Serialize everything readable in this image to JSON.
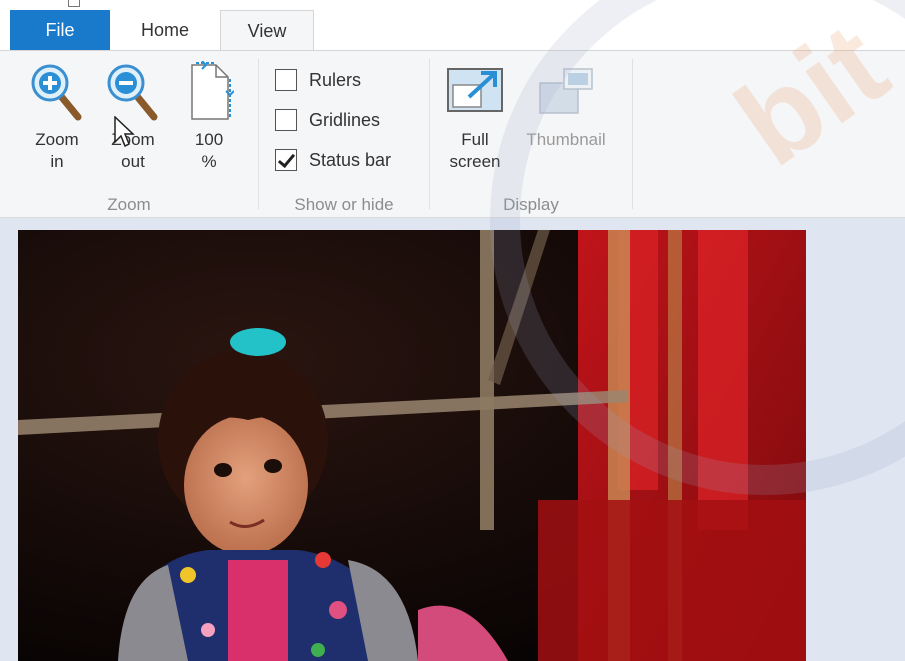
{
  "tabs": [
    {
      "label": "File"
    },
    {
      "label": "Home"
    },
    {
      "label": "View"
    }
  ],
  "ribbon": {
    "zoom_group": {
      "label": "Zoom",
      "zoom_in": {
        "line1": "Zoom",
        "line2": "in",
        "icon": "zoom-in-icon"
      },
      "zoom_out": {
        "line1": "Zoom",
        "line2": "out",
        "icon": "zoom-out-icon"
      },
      "zoom_100": {
        "line1": "100",
        "line2": "%",
        "icon": "actual-size-icon"
      }
    },
    "show_hide_group": {
      "label": "Show or hide",
      "rulers": {
        "label": "Rulers",
        "checked": false
      },
      "gridlines": {
        "label": "Gridlines",
        "checked": false
      },
      "status_bar": {
        "label": "Status bar",
        "checked": true
      }
    },
    "display_group": {
      "label": "Display",
      "full_screen": {
        "line1": "Full",
        "line2": "screen",
        "icon": "full-screen-icon"
      },
      "thumbnail": {
        "label": "Thumbnail",
        "icon": "thumbnail-icon",
        "enabled": false
      }
    }
  },
  "canvas": {
    "background": "#dfe6f2",
    "image": "photo-of-young-girl"
  },
  "colors": {
    "file_tab": "#1979ca",
    "ribbon_bg": "#f5f6f7",
    "accent_icon": "#2b8fd6"
  }
}
